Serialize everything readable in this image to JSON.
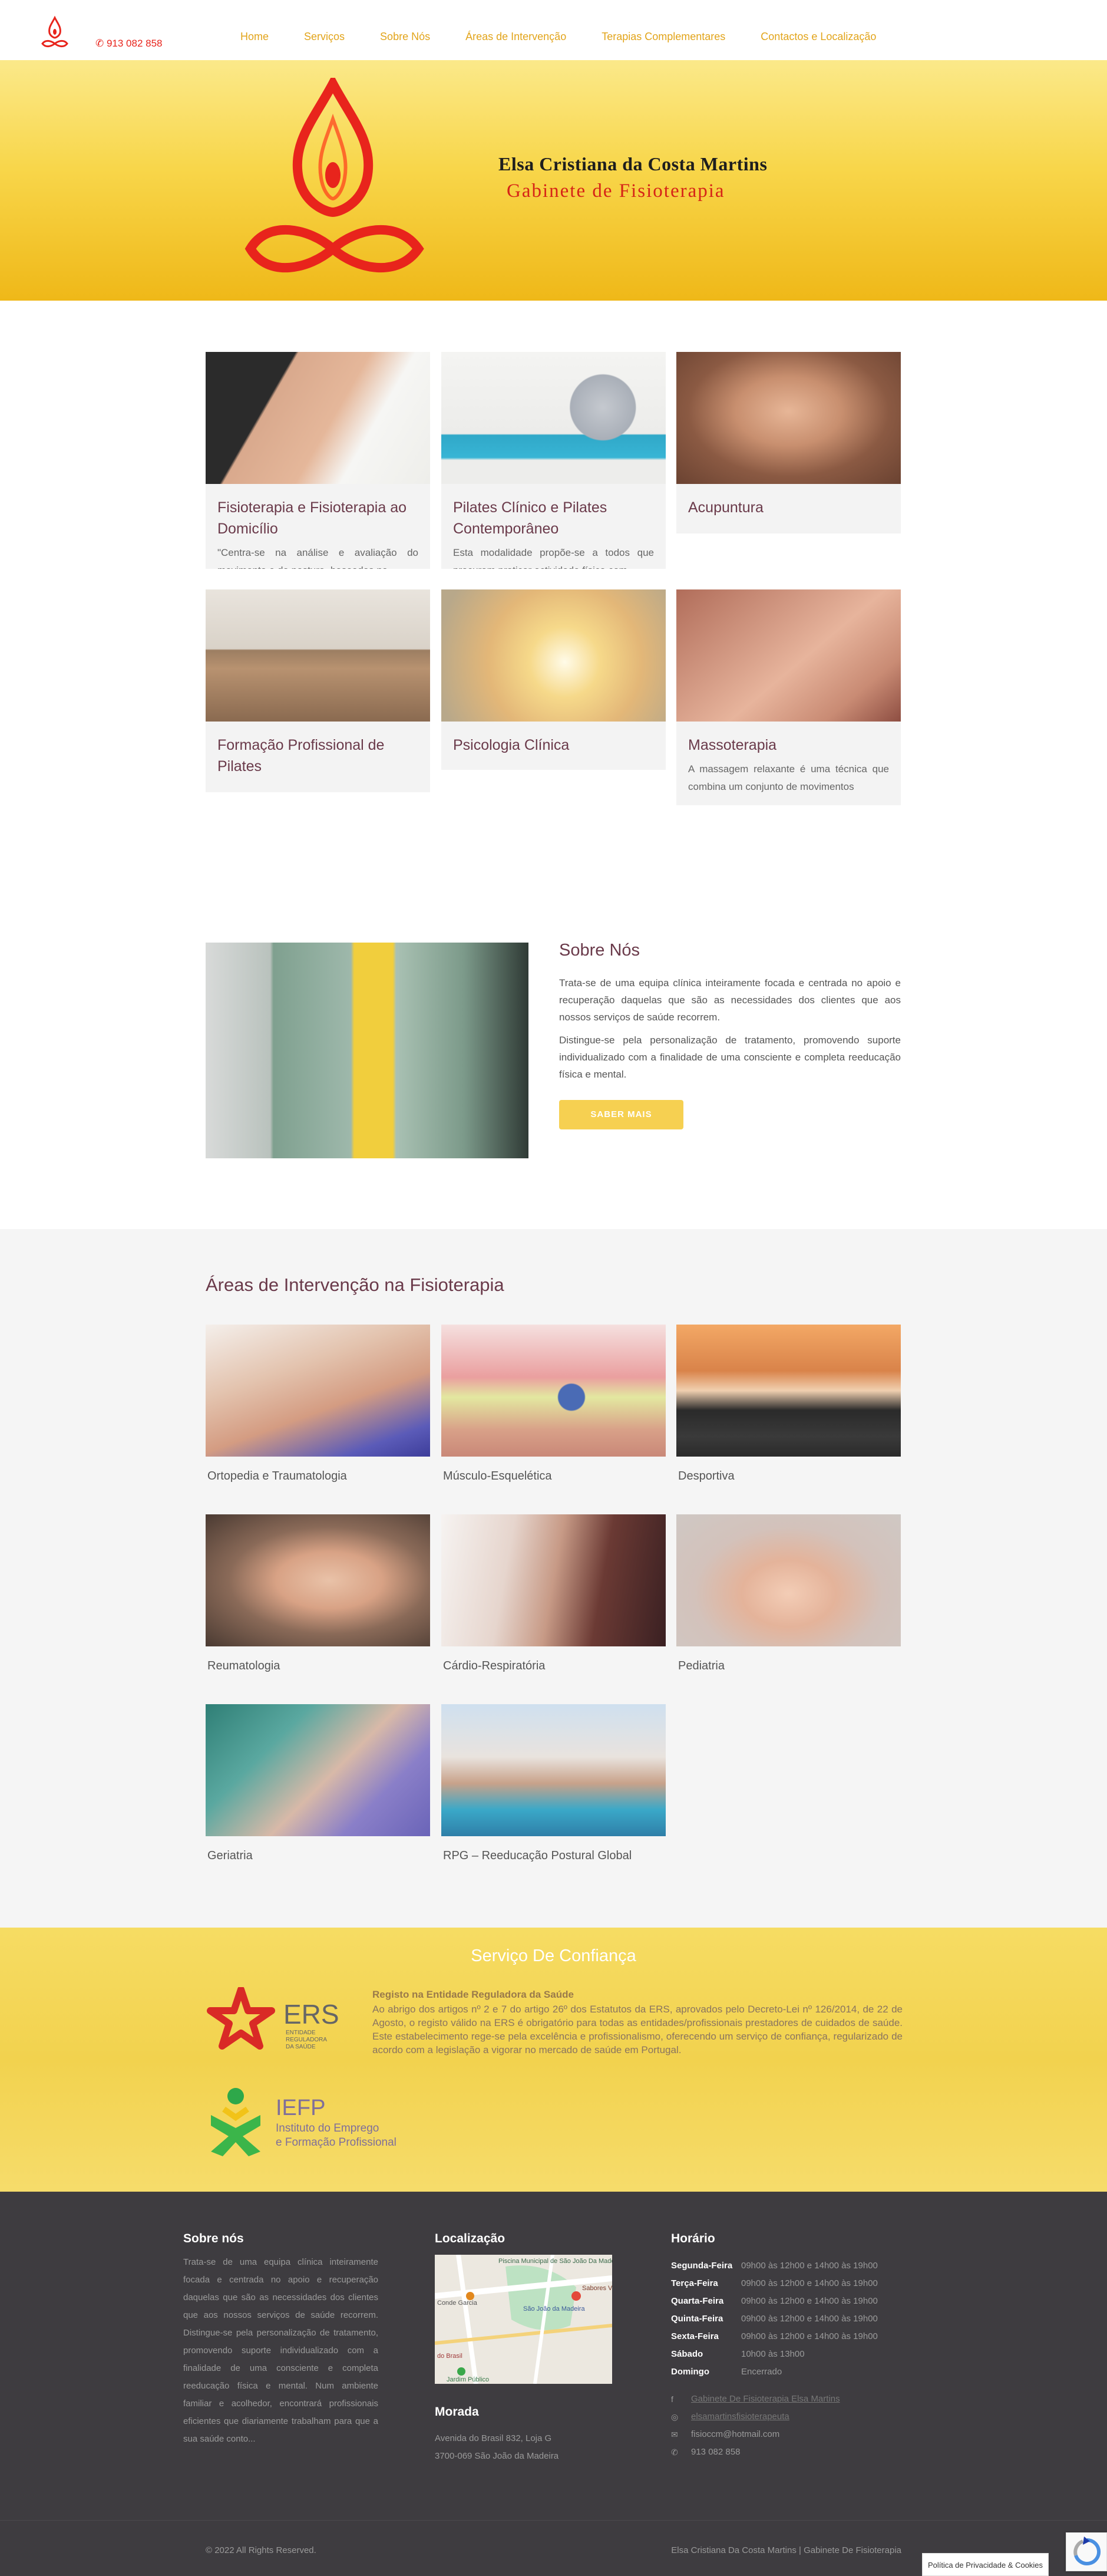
{
  "nav": {
    "phone": "913 082 858",
    "items": [
      "Home",
      "Serviços",
      "Sobre Nós",
      "Áreas de Intervenção",
      "Terapias Complementares",
      "Contactos e Localização"
    ]
  },
  "hero": {
    "name": "Elsa Cristiana da Costa Martins",
    "subtitle": "Gabinete de Fisioterapia"
  },
  "services": [
    {
      "title": "Fisioterapia e Fisioterapia ao Domicílio",
      "text": "\"Centra-se na análise e avaliação do movimento e da postura, baseadas na"
    },
    {
      "title": "Pilates Clínico e Pilates Contemporâneo",
      "text": "Esta modalidade propõe-se a todos que procuram praticar actividade física com"
    },
    {
      "title": "Acupuntura",
      "text": ""
    },
    {
      "title": "Formação Profissional de Pilates",
      "text": ""
    },
    {
      "title": "Psicologia Clínica",
      "text": ""
    },
    {
      "title": "Massoterapia",
      "text": "A massagem relaxante é uma técnica que combina um conjunto de movimentos"
    }
  ],
  "about": {
    "title": "Sobre Nós",
    "p1": "Trata-se de uma equipa clínica inteiramente focada e centrada no apoio e recuperação daquelas que são as necessidades dos clientes que aos nossos serviços de saúde recorrem.",
    "p2": "Distingue-se pela personalização de tratamento, promovendo suporte individualizado com a finalidade de uma consciente e completa reeducação física e mental.",
    "button": "SABER MAIS"
  },
  "areas": {
    "title": "Áreas de Intervenção na Fisioterapia",
    "items": [
      "Ortopedia e Traumatologia",
      "Músculo-Esquelética",
      "Desportiva",
      "Reumatologia",
      "Cárdio-Respiratória",
      "Pediatria",
      "Geriatria",
      "RPG – Reeducação Postural Global"
    ]
  },
  "trust": {
    "title": "Serviço De Confiança",
    "ers_heading": "Registo na Entidade Reguladora da Saúde",
    "ers_text": "Ao abrigo dos artigos nº 2 e 7 do artigo 26º dos Estatutos da ERS, aprovados pelo Decreto-Lei nº 126/2014, de 22 de Agosto, o registo válido na ERS é obrigatório para todas as entidades/profissionais prestadores de cuidados de saúde. Este estabelecimento rege-se pela excelência e profissionalismo, oferecendo um serviço de confiança, regularizado de acordo com a legislação a vigorar no mercado de saúde em Portugal.",
    "ers_logo_big": "ERS",
    "ers_logo_small": [
      "ENTIDADE",
      "REGULADORA",
      "DA SAÚDE"
    ],
    "iefp_logo_big": "IEFP",
    "iefp_logo_small": [
      "Instituto do Emprego",
      "e Formação Profissional"
    ]
  },
  "footer": {
    "about_title": "Sobre nós",
    "about_text": "Trata-se de uma equipa clínica inteiramente focada e centrada no apoio e recuperação daquelas que são as necessidades dos clientes que aos nossos serviços de saúde recorrem. Distingue-se pela personalização de tratamento, promovendo suporte individualizado com a finalidade de uma consciente e completa reeducação física e mental. Num ambiente familiar e acolhedor, encontrará profissionais eficientes que diariamente trabalham para que a sua saúde conto...",
    "location_title": "Localização",
    "map_labels": [
      "Piscina Municipal de São João Da Madeira",
      "Sabores V",
      "Conde Garcia",
      "São João da Madeira",
      "Jardim Público",
      "do Brasil"
    ],
    "address_title": "Morada",
    "address_line1": "Avenida do Brasil 832, Loja G",
    "address_line2": "3700-069 São João da Madeira",
    "hours_title": "Horário",
    "hours": [
      {
        "day": "Segunda-Feira",
        "time": "09h00 às 12h00 e 14h00 às 19h00"
      },
      {
        "day": "Terça-Feira",
        "time": "09h00 às 12h00 e 14h00 às 19h00"
      },
      {
        "day": "Quarta-Feira",
        "time": "09h00 às 12h00 e 14h00 às 19h00"
      },
      {
        "day": "Quinta-Feira",
        "time": "09h00 às 12h00 e 14h00 às 19h00"
      },
      {
        "day": "Sexta-Feira",
        "time": "09h00 às 12h00 e 14h00 às 19h00"
      },
      {
        "day": "Sábado",
        "time": "10h00 às 13h00"
      },
      {
        "day": "Domingo",
        "time": "Encerrado"
      }
    ],
    "facebook": "Gabinete De Fisioterapia Elsa Martins",
    "instagram": "elsamartinsfisioterapeuta",
    "email": "fisioccm@hotmail.com",
    "phone": "913 082 858",
    "copyright": "© 2022 All Rights Reserved.",
    "credit": "Elsa Cristiana Da Costa Martins | Gabinete De Fisioterapia",
    "privacy": "Política de Privacidade & Cookies"
  },
  "colors": {
    "accent": "#e2a41a",
    "logo_red": "#e8241c",
    "title_purple": "#6a3a4a",
    "footer_bg": "#3e3c40"
  }
}
